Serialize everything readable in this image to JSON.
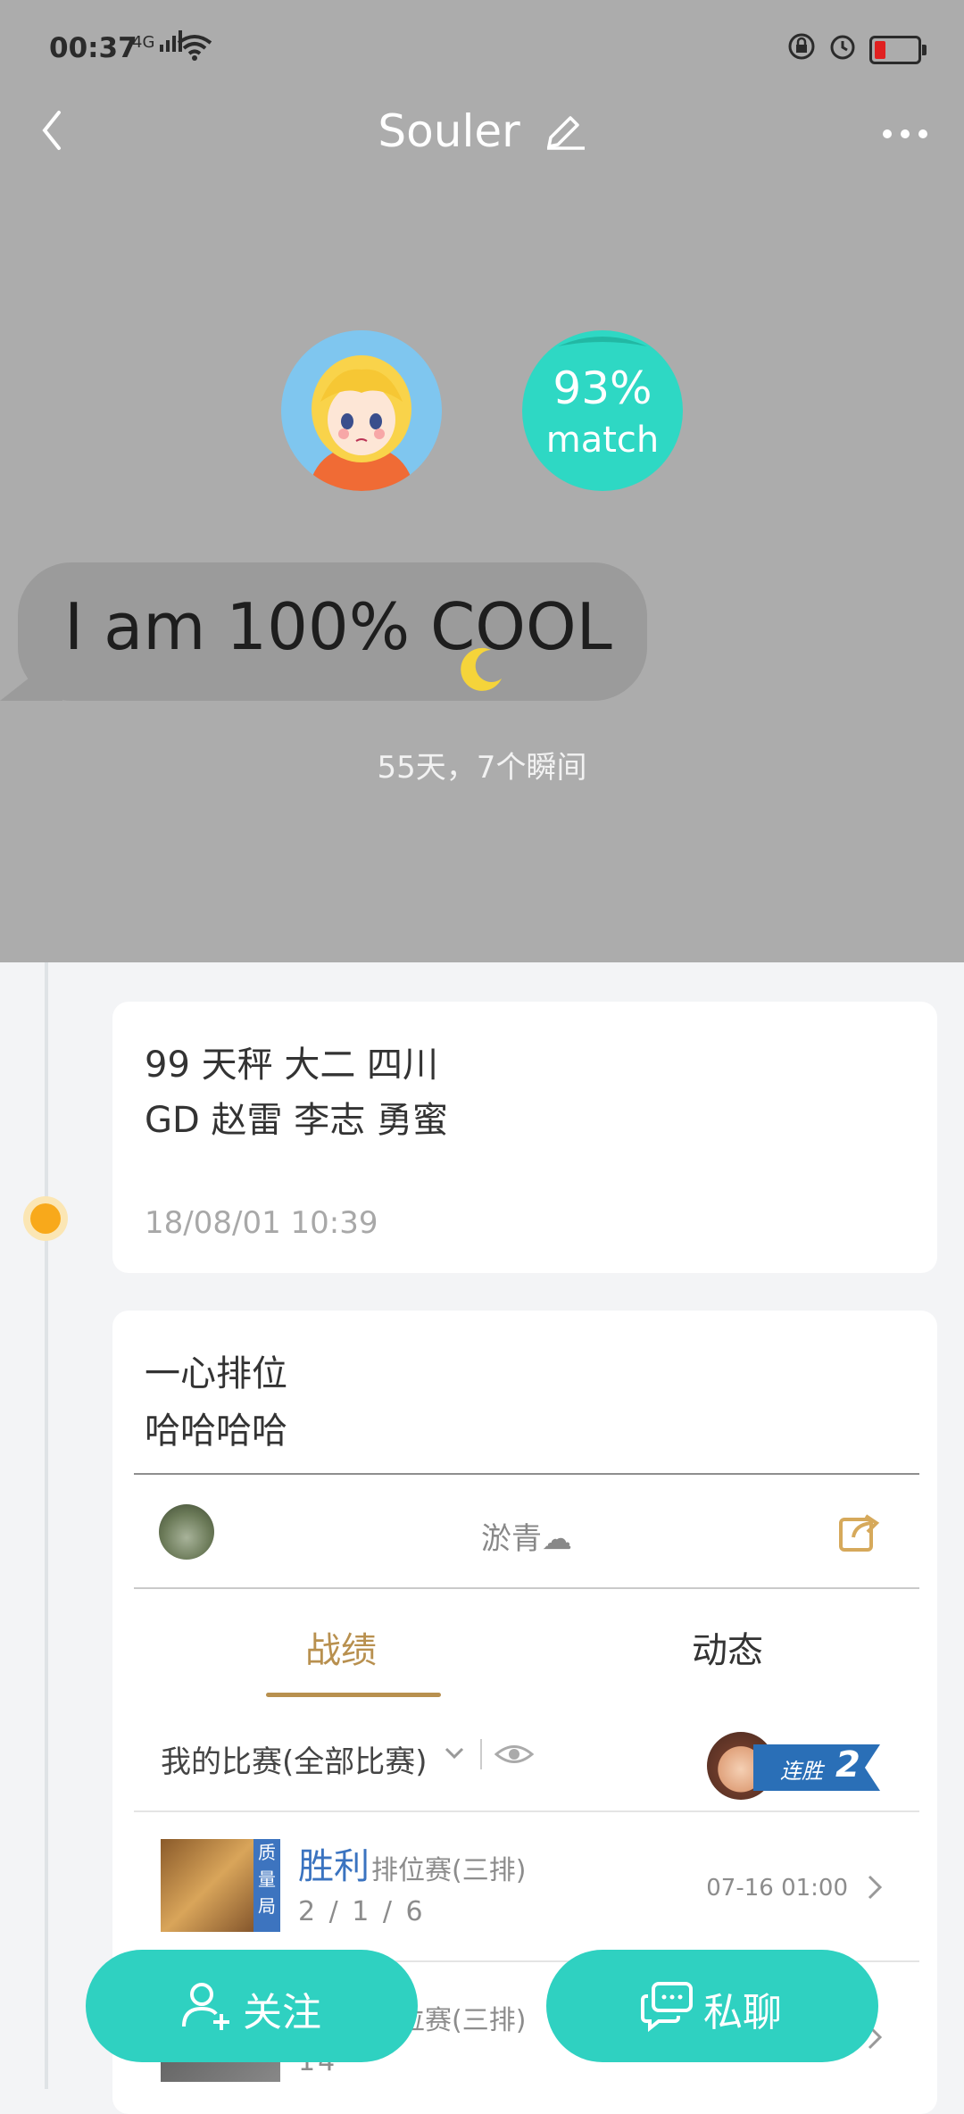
{
  "status_bar": {
    "time": "00:37",
    "network": "4G"
  },
  "header": {
    "title": "Souler",
    "match_percent": "93%",
    "match_label": "match",
    "bubble_text": "I am 100% COOL",
    "days_text": "55天，7个瞬间"
  },
  "posts": [
    {
      "line1": "99  天秤 大二 四川",
      "line2": "GD 赵雷 李志 勇蜜",
      "time": "18/08/01 10:39"
    },
    {
      "line1": "一心排位",
      "line2": "哈哈哈哈",
      "embed": {
        "user_name": "淤青☁",
        "tabs": [
          "战绩",
          "动态"
        ],
        "filter_label": "我的比赛(全部比赛)",
        "streak_label": "连胜",
        "streak_count": "2",
        "matches": [
          {
            "hero_tag": "质量局",
            "result": "胜利",
            "mode": "排位赛(三排)",
            "kda": "2 / 1 / 6",
            "time": "07-16 01:00"
          },
          {
            "hero_tag": "",
            "result": "",
            "mode": "排位赛(三排)",
            "kda": "14",
            "time": ""
          }
        ]
      }
    }
  ],
  "actions": {
    "follow_label": "关注",
    "chat_label": "私聊"
  },
  "colors": {
    "header_bg": "#acacac",
    "accent": "#2fd1c1",
    "gold": "#b8904f"
  }
}
